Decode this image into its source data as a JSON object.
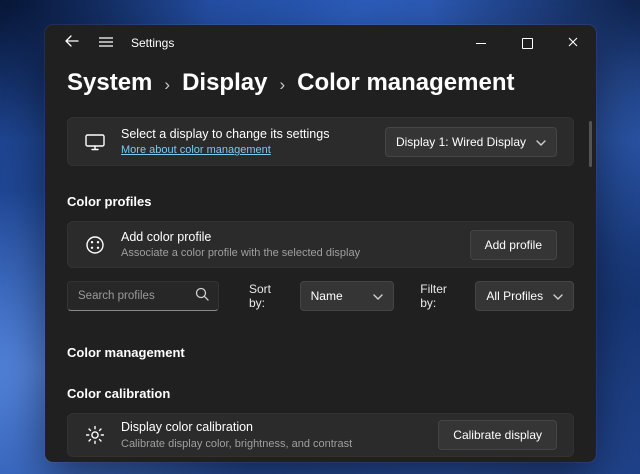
{
  "colors": {
    "link": "#7fc9ef"
  },
  "titlebar": {
    "title": "Settings"
  },
  "breadcrumb": {
    "separator": "›",
    "items": [
      "System",
      "Display",
      "Color management"
    ]
  },
  "display_card": {
    "title": "Select a display to change its settings",
    "link": "More about color management",
    "selected_display": "Display 1: Wired Display"
  },
  "profiles": {
    "heading": "Color profiles",
    "add": {
      "title": "Add color profile",
      "subtitle": "Associate a color profile with the selected display",
      "button": "Add profile"
    },
    "search_placeholder": "Search profiles",
    "sort_label": "Sort by:",
    "sort_value": "Name",
    "filter_label": "Filter by:",
    "filter_value": "All Profiles"
  },
  "management": {
    "heading": "Color management"
  },
  "calibration": {
    "heading": "Color calibration",
    "title": "Display color calibration",
    "subtitle": "Calibrate display color, brightness, and contrast",
    "button": "Calibrate display"
  }
}
